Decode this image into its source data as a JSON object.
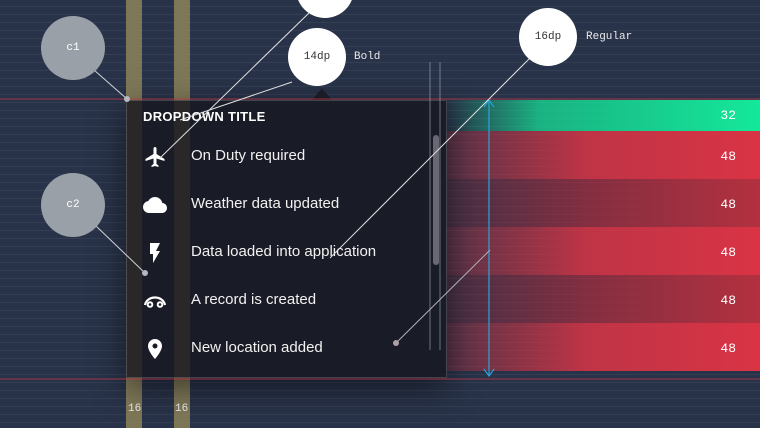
{
  "dropdown": {
    "title": "DROPDOWN TITLE",
    "items": [
      {
        "icon": "airplane-icon",
        "label": "On Duty required"
      },
      {
        "icon": "cloud-icon",
        "label": "Weather data updated"
      },
      {
        "icon": "lightning-icon",
        "label": "Data loaded into application"
      },
      {
        "icon": "eye-icon",
        "label": "A record is created"
      },
      {
        "icon": "location-pin-icon",
        "label": "New location added"
      }
    ]
  },
  "spec": {
    "header_height": "32",
    "row_heights": [
      "48",
      "48",
      "48",
      "48",
      "48"
    ],
    "title_font": {
      "size": "14dp",
      "weight": "Bold"
    },
    "item_font": {
      "size": "16dp",
      "weight": "Regular"
    },
    "circle_c1": "c1",
    "circle_c2": "c2",
    "padding_left": "16",
    "padding_icon": "16"
  },
  "colors": {
    "background": "#283248",
    "header_band": "#14e89a",
    "row_band": "#d93445",
    "guide_line": "#c0394b",
    "measure": "#2aa3d8"
  }
}
